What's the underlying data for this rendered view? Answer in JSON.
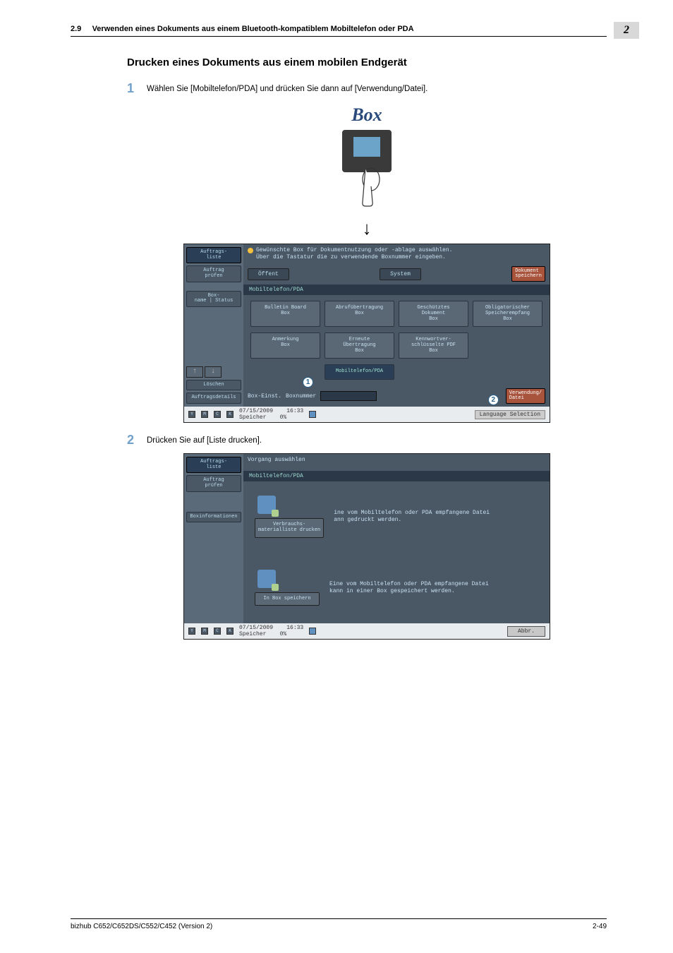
{
  "header": {
    "section_num": "2.9",
    "section_title": "Verwenden eines Dokuments aus einem Bluetooth-kompatiblem Mobiltelefon oder PDA",
    "chapter_badge": "2"
  },
  "content": {
    "heading": "Drucken eines Dokuments aus einem mobilen Endgerät",
    "step1_num": "1",
    "step1_text": "Wählen Sie [Mobiltelefon/PDA] und drücken Sie dann auf [Verwendung/Datei].",
    "box_label": "Box",
    "arrow": "↓",
    "step2_num": "2",
    "step2_text": "Drücken Sie auf [Liste drucken]."
  },
  "screenshot1": {
    "sidebar": {
      "job_list": "Auftrags-\nliste",
      "job_check": "Auftrag\nprüfen",
      "box_status": "Box-\nname | Status",
      "delete": "Löschen",
      "details": "Auftragsdetails"
    },
    "banner": "Gewünschte Box für Dokumentnutzung oder -ablage auswählen.\nÜber die Tastatur die zu verwendende Boxnummer eingeben.",
    "tabs": {
      "public": "Öffent",
      "system": "System",
      "save": "Dokument\nspeichern"
    },
    "strip": "Mobiltelefon/PDA",
    "tiles": {
      "r1": [
        "Bulletin Board\nBox",
        "Abrufübertragung\nBox",
        "Geschütztes\nDokument\nBox",
        "Obligatorischer\nSpeicherempfang\nBox"
      ],
      "r2": [
        "Anmerkung\nBox",
        "Erneute\nÜbertragung\nBox",
        "Kennwortver-\nschlüsselte PDF\nBox",
        ""
      ],
      "r3": [
        "",
        "Mobiltelefon/PDA",
        "",
        ""
      ]
    },
    "callout1": "1",
    "callout2": "2",
    "bottom": {
      "box_set": "Box-Einst.",
      "box_num": "Boxnummer",
      "use": "Verwendung/\nDatei"
    },
    "status": {
      "date": "07/15/2009",
      "time": "16:33",
      "mem": "Speicher",
      "mempct": "0%",
      "lang": "Language Selection",
      "letters": [
        "Y",
        "M",
        "C",
        "K"
      ]
    }
  },
  "screenshot2": {
    "sidebar": {
      "job_list": "Auftrags-\nliste",
      "job_check": "Auftrag\nprüfen",
      "boxinfo": "Boxinformationen"
    },
    "banner": "Vorgang auswählen",
    "strip": "Mobiltelefon/PDA",
    "panel1": {
      "btn": "Verbrauchs-\nmaterialliste drucken",
      "text": "ine vom Mobiltelefon oder PDA empfangene Datei\nann gedruckt werden."
    },
    "panel2": {
      "btn": "In Box speichern",
      "text": "Eine vom Mobiltelefon oder PDA empfangene Datei\nkann in einer Box gespeichert werden."
    },
    "abbr": "Abbr.",
    "status": {
      "date": "07/15/2009",
      "time": "16:33",
      "mem": "Speicher",
      "mempct": "0%",
      "letters": [
        "Y",
        "M",
        "C",
        "K"
      ]
    }
  },
  "footer": {
    "left": "bizhub C652/C652DS/C552/C452 (Version 2)",
    "right": "2-49"
  }
}
